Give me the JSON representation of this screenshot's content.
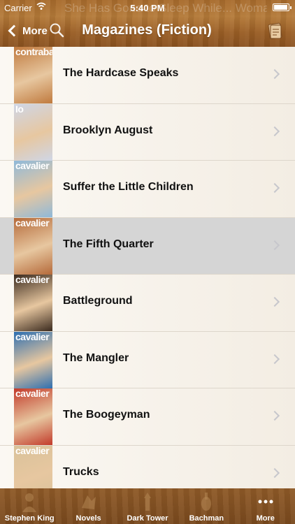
{
  "status": {
    "carrier": "Carrier",
    "time": "5:40 PM"
  },
  "header": {
    "ghost_title": "She Has Gone to Sleep While... Woman With Child",
    "back_label": "More",
    "title": "Magazines (Fiction)"
  },
  "list": {
    "items": [
      {
        "title": "The Hardcase Speaks",
        "cover_label": "contraband",
        "cover_bg": "#c07a3e",
        "selected": false
      },
      {
        "title": "Brooklyn August",
        "cover_label": "Io",
        "cover_bg": "#cfd6e6",
        "selected": false
      },
      {
        "title": "Suffer the Little Children",
        "cover_label": "cavalier",
        "cover_bg": "#8fb9d9",
        "selected": false
      },
      {
        "title": "The Fifth Quarter",
        "cover_label": "cavalier",
        "cover_bg": "#b56a3a",
        "selected": true
      },
      {
        "title": "Battleground",
        "cover_label": "cavalier",
        "cover_bg": "#3a2a1e",
        "selected": false
      },
      {
        "title": "The Mangler",
        "cover_label": "cavalier",
        "cover_bg": "#2e6fb0",
        "selected": false
      },
      {
        "title": "The Boogeyman",
        "cover_label": "cavalier",
        "cover_bg": "#c23a2a",
        "selected": false
      },
      {
        "title": "Trucks",
        "cover_label": "cavalier",
        "cover_bg": "#d9c29a",
        "selected": false
      }
    ]
  },
  "tabbar": {
    "tabs": [
      {
        "label": "Stephen King",
        "icon": "stephen-king-icon"
      },
      {
        "label": "Novels",
        "icon": "novels-icon"
      },
      {
        "label": "Dark Tower",
        "icon": "dark-tower-icon"
      },
      {
        "label": "Bachman",
        "icon": "bachman-icon"
      },
      {
        "label": "More",
        "icon": "more-dots-icon"
      }
    ]
  },
  "colors": {
    "wood": "#a86b2c",
    "selected_row": "#d5d5d5",
    "chevron": "#c7c7cc"
  }
}
